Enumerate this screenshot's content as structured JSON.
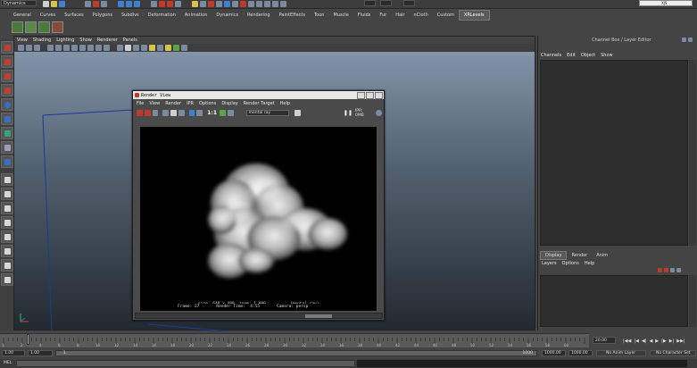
{
  "top": {
    "menu_set": "Dynamics",
    "shelf_tabs": [
      "General",
      "Curves",
      "Surfaces",
      "Polygons",
      "Subdivs",
      "Deformation",
      "Animation",
      "Dynamics",
      "Rendering",
      "PaintEffects",
      "Toon",
      "Muscle",
      "Fluids",
      "Fur",
      "Hair",
      "nCloth",
      "Custom",
      "XRLevels"
    ],
    "status_text": "XJS"
  },
  "viewport": {
    "menu": [
      "View",
      "Shading",
      "Lighting",
      "Show",
      "Renderer",
      "Panels"
    ]
  },
  "render_view": {
    "title": "Render View",
    "menu": [
      "File",
      "View",
      "Render",
      "IPR",
      "Options",
      "Display",
      "Render Target",
      "Help"
    ],
    "ratio": "1:1",
    "renderer": "mental ray",
    "ipr_label": "IPR: 0MB",
    "stats_line1": "size: 640 x 480  zoom: 1.000          (mental ray)",
    "stats_line2": "Frame: 27       Render Time:  4:55       Camera: persp"
  },
  "channel_box": {
    "title": "Channel Box / Layer Editor",
    "menu": [
      "Channels",
      "Edit",
      "Object",
      "Show"
    ]
  },
  "layer_editor": {
    "tabs": [
      "Display",
      "Render",
      "Anim"
    ],
    "menu": [
      "Layers",
      "Options",
      "Help"
    ]
  },
  "timeline": {
    "ticks": [
      "1",
      "2",
      "4",
      "6",
      "8",
      "10",
      "12",
      "14",
      "16",
      "18",
      "20",
      "22",
      "24",
      "26",
      "28",
      "30",
      "32",
      "34",
      "36",
      "38",
      "40",
      "42",
      "44",
      "46",
      "48",
      "50",
      "52",
      "54",
      "56",
      "58",
      "60"
    ],
    "current_frame": "20.00"
  },
  "range": {
    "start": "1.00",
    "start2": "1.00",
    "playback_start": "1",
    "playback_end": "1000",
    "end": "1000.00",
    "end2": "1000.00",
    "anim_layer": "No Anim Layer",
    "char_set": "No Character Set"
  },
  "command_line": {
    "label": "MEL"
  }
}
